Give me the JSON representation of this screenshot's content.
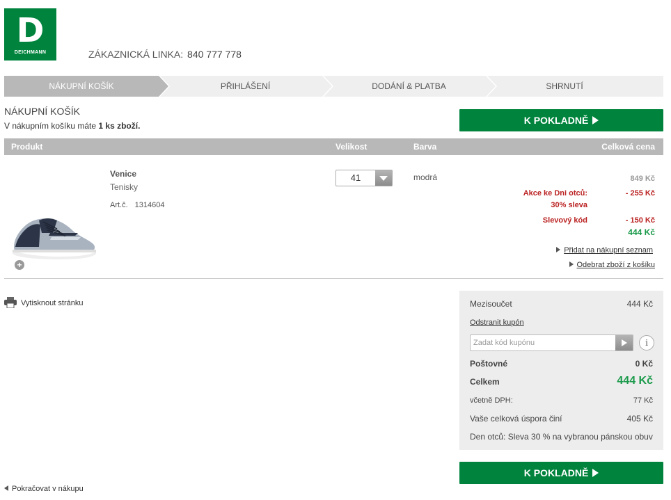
{
  "brand": {
    "logo_letter": "D",
    "logo_text": "DEICHMANN",
    "color": "#00843d"
  },
  "hotline": {
    "label": "ZÁKAZNICKÁ LINKA:",
    "number": "840 777 778"
  },
  "steps": [
    {
      "label": "NÁKUPNÍ KOŠÍK",
      "active": true
    },
    {
      "label": "PŘIHLÁŠENÍ",
      "active": false
    },
    {
      "label": "DODÁNÍ & PLATBA",
      "active": false
    },
    {
      "label": "SHRNUTÍ",
      "active": false
    }
  ],
  "cart": {
    "title": "NÁKUPNÍ KOŠÍK",
    "subtitle_prefix": "V nákupním košíku máte ",
    "subtitle_count": "1 ks zboží.",
    "checkout_label": "K POKLADNĚ"
  },
  "table": {
    "col_product": "Produkt",
    "col_size": "Velikost",
    "col_color": "Barva",
    "col_total": "Celková cena"
  },
  "item": {
    "name": "Venice",
    "type": "Tenisky",
    "art_label": "Art.č.",
    "art_number": "1314604",
    "size": "41",
    "color": "modrá",
    "price_original": "849 Kč",
    "promo_label_1": "Akce ke Dni otců:",
    "promo_label_2": "30% sleva",
    "promo_discount": "- 255 Kč",
    "voucher_label": "Slevový kód",
    "voucher_discount": "- 150 Kč",
    "price_final": "444 Kč",
    "add_to_list": "Přidat na nákupní seznam",
    "remove": "Odebrat zboží z košíku",
    "zoom_icon": "+"
  },
  "print_label": "Vytisknout stránku",
  "summary": {
    "subtotal_label": "Mezisoučet",
    "subtotal": "444 Kč",
    "remove_coupon": "Odstranit kupón",
    "coupon_placeholder": "Zadat kód kupónu",
    "info_icon": "i",
    "shipping_label": "Poštovné",
    "shipping": "0 Kč",
    "total_label": "Celkem",
    "total": "444 Kč",
    "vat_label": "včetně DPH:",
    "vat": "77 Kč",
    "savings_label": "Vaše celková úspora činí",
    "savings": "405 Kč",
    "promo_note": "Den otců: Sleva 30 % na vybranou pánskou obuv"
  },
  "continue_label": "Pokračovat v nákupu"
}
